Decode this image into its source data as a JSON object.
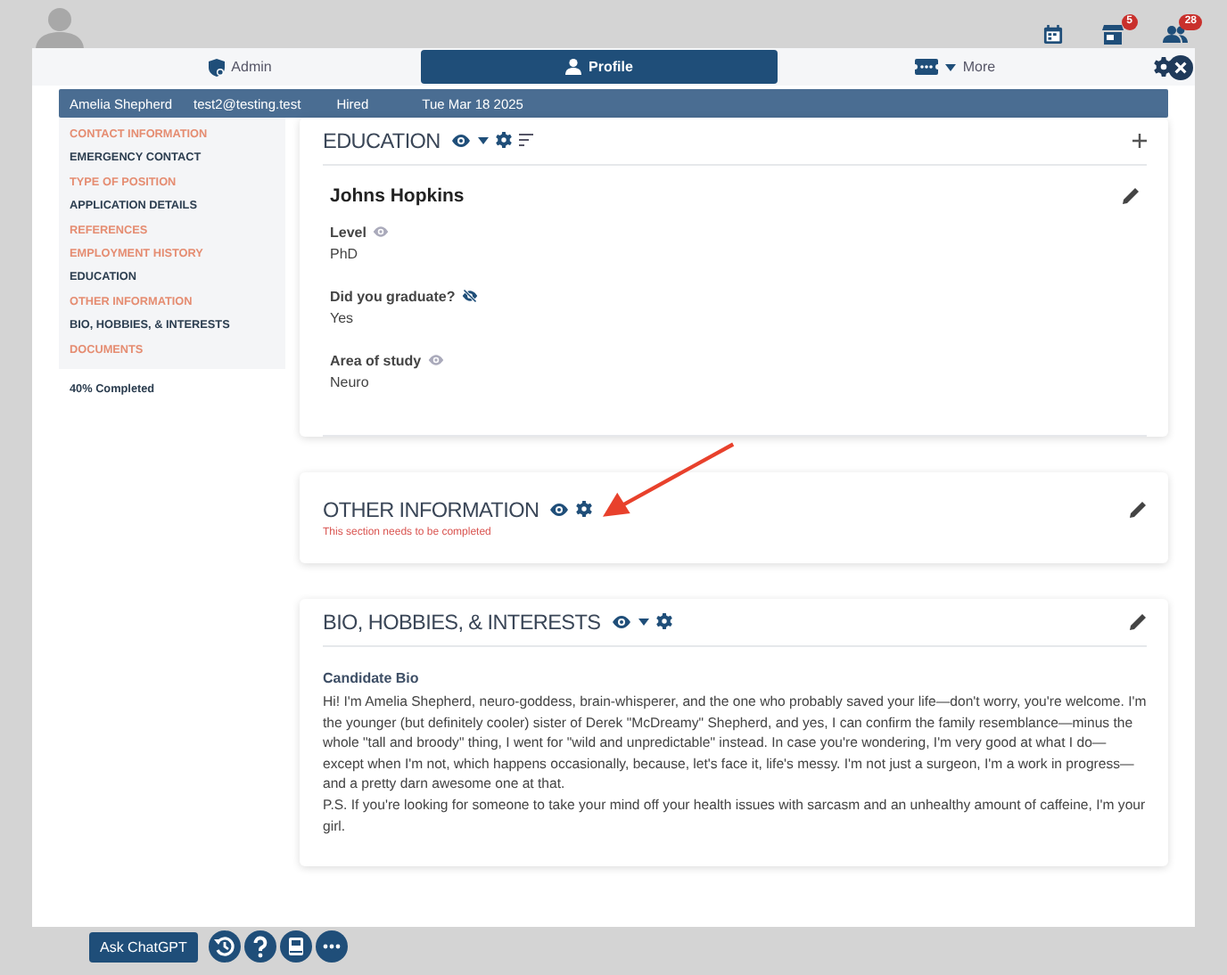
{
  "top_bar": {
    "icons": [
      {
        "kind": "calendar"
      },
      {
        "kind": "store",
        "badge": "5"
      },
      {
        "kind": "people",
        "badge": "28"
      }
    ]
  },
  "tabs": [
    {
      "kind": "admin",
      "label": "Admin",
      "selected": false
    },
    {
      "kind": "profile",
      "label": "Profile",
      "selected": true
    },
    {
      "kind": "more",
      "label": "More",
      "selected": false
    }
  ],
  "info_bar": [
    "Amelia Shepherd",
    "test2@testing.test",
    "Hired",
    "Tue Mar 18 2025"
  ],
  "sidebar": {
    "items": [
      {
        "label": "CONTACT INFORMATION",
        "completed": false
      },
      {
        "label": "EMERGENCY CONTACT",
        "completed": true
      },
      {
        "label": "TYPE OF POSITION",
        "completed": false
      },
      {
        "label": "APPLICATION DETAILS",
        "completed": true
      },
      {
        "label": "REFERENCES",
        "completed": false
      },
      {
        "label": "EMPLOYMENT HISTORY",
        "completed": false
      },
      {
        "label": "EDUCATION",
        "completed": true
      },
      {
        "label": "OTHER INFORMATION",
        "completed": false
      },
      {
        "label": "BIO, HOBBIES, & INTERESTS",
        "completed": true
      },
      {
        "label": "DOCUMENTS",
        "completed": false
      }
    ],
    "progress": "40% Completed"
  },
  "sections": [
    {
      "kind": "entries",
      "title": "EDUCATION",
      "tools": [
        {
          "kind": "eye"
        },
        {
          "kind": "caret"
        },
        {
          "kind": "gear"
        },
        {
          "kind": "sort"
        }
      ],
      "action": {
        "kind": "add"
      },
      "entries": [
        {
          "title": "Johns Hopkins",
          "fields": [
            {
              "label": "Level",
              "visible": true,
              "value": "PhD"
            },
            {
              "label": "Did you graduate?",
              "visible": false,
              "value": "Yes"
            },
            {
              "label": "Area of study",
              "visible": true,
              "value": "Neuro"
            }
          ]
        }
      ]
    },
    {
      "kind": "notice",
      "title": "OTHER INFORMATION",
      "tools": [
        {
          "kind": "eye"
        },
        {
          "kind": "gear"
        }
      ],
      "action": {
        "kind": "edit"
      },
      "notice": "This section needs to be completed"
    },
    {
      "kind": "text",
      "title": "BIO, HOBBIES, & INTERESTS",
      "tools": [
        {
          "kind": "eye"
        },
        {
          "kind": "caret"
        },
        {
          "kind": "gear"
        }
      ],
      "action": {
        "kind": "edit"
      },
      "label": "Candidate Bio",
      "paragraphs": [
        "Hi! I'm Amelia Shepherd, neuro-goddess, brain-whisperer, and the one who probably saved your life—don't worry, you're welcome. I'm the younger (but definitely cooler) sister of Derek \"McDreamy\" Shepherd, and yes, I can confirm the family resemblance—minus the whole \"tall and broody\" thing, I went for \"wild and unpredictable\" instead.  In case you're wondering, I'm very good at what I do—except when I'm not, which happens occasionally, because, let's face it, life's messy. I'm not just a surgeon, I'm a work in progress—and a pretty darn awesome one at that.",
        "P.S. If you're looking for someone to take your mind off your health issues with sarcasm and an unhealthy amount of caffeine, I'm your girl."
      ]
    }
  ],
  "dock": {
    "button": "Ask ChatGPT",
    "icons": [
      {
        "kind": "history"
      },
      {
        "kind": "help"
      },
      {
        "kind": "book"
      },
      {
        "kind": "more"
      }
    ]
  }
}
